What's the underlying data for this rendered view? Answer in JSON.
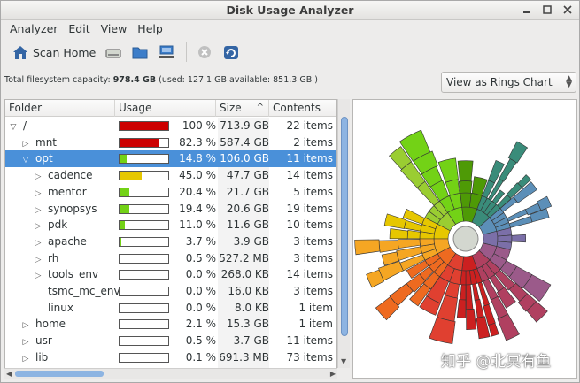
{
  "window": {
    "title": "Disk Usage Analyzer"
  },
  "menu": [
    "Analyzer",
    "Edit",
    "View",
    "Help"
  ],
  "toolbar": {
    "scan_home_label": "Scan Home",
    "buttons": [
      "scan-home",
      "scan-filesystem",
      "scan-folder",
      "scan-remote",
      "stop",
      "refresh"
    ]
  },
  "info": {
    "prefix": "Total filesystem capacity:",
    "capacity": "978.4 GB",
    "details": "(used: 127.1 GB available: 851.3 GB )"
  },
  "view_selector": {
    "value": "View as Rings Chart"
  },
  "columns": {
    "folder": "Folder",
    "usage": "Usage",
    "size": "Size",
    "contents": "Contents"
  },
  "rows": [
    {
      "name": "/",
      "indent": 0,
      "expander": "open",
      "pct": "100 %",
      "fill": 1.0,
      "bar_color": "#cc0000",
      "size": "713.9 GB",
      "items": "22 items",
      "selected": false
    },
    {
      "name": "mnt",
      "indent": 1,
      "expander": "closed",
      "pct": "82.3 %",
      "fill": 0.823,
      "bar_color": "#cc0000",
      "size": "587.4 GB",
      "items": "2 items",
      "selected": false
    },
    {
      "name": "opt",
      "indent": 1,
      "expander": "open",
      "pct": "14.8 %",
      "fill": 0.148,
      "bar_color": "#73d216",
      "size": "106.0 GB",
      "items": "11 items",
      "selected": true
    },
    {
      "name": "cadence",
      "indent": 2,
      "expander": "closed",
      "pct": "45.0 %",
      "fill": 0.45,
      "bar_color": "#e6c700",
      "size": "47.7 GB",
      "items": "14 items",
      "selected": false
    },
    {
      "name": "mentor",
      "indent": 2,
      "expander": "closed",
      "pct": "20.4 %",
      "fill": 0.204,
      "bar_color": "#73d216",
      "size": "21.7 GB",
      "items": "5 items",
      "selected": false
    },
    {
      "name": "synopsys",
      "indent": 2,
      "expander": "closed",
      "pct": "19.4 %",
      "fill": 0.194,
      "bar_color": "#73d216",
      "size": "20.6 GB",
      "items": "19 items",
      "selected": false
    },
    {
      "name": "pdk",
      "indent": 2,
      "expander": "closed",
      "pct": "11.0 %",
      "fill": 0.11,
      "bar_color": "#73d216",
      "size": "11.6 GB",
      "items": "10 items",
      "selected": false
    },
    {
      "name": "apache",
      "indent": 2,
      "expander": "closed",
      "pct": "3.7 %",
      "fill": 0.037,
      "bar_color": "#73d216",
      "size": "3.9 GB",
      "items": "3 items",
      "selected": false
    },
    {
      "name": "rh",
      "indent": 2,
      "expander": "closed",
      "pct": "0.5 %",
      "fill": 0.005,
      "bar_color": "#73d216",
      "size": "527.2 MB",
      "items": "3 items",
      "selected": false
    },
    {
      "name": "tools_env",
      "indent": 2,
      "expander": "closed",
      "pct": "0.0 %",
      "fill": 0.0,
      "bar_color": "#73d216",
      "size": "268.0 KB",
      "items": "14 items",
      "selected": false
    },
    {
      "name": "tsmc_mc_env",
      "indent": 2,
      "expander": "none",
      "pct": "0.0 %",
      "fill": 0.0,
      "bar_color": "#73d216",
      "size": "16.0 KB",
      "items": "3 items",
      "selected": false
    },
    {
      "name": "linux",
      "indent": 2,
      "expander": "none",
      "pct": "0.0 %",
      "fill": 0.0,
      "bar_color": "#73d216",
      "size": "8.0 KB",
      "items": "1 item",
      "selected": false
    },
    {
      "name": "home",
      "indent": 1,
      "expander": "closed",
      "pct": "2.1 %",
      "fill": 0.021,
      "bar_color": "#cc0000",
      "size": "15.3 GB",
      "items": "1 item",
      "selected": false
    },
    {
      "name": "usr",
      "indent": 1,
      "expander": "closed",
      "pct": "0.5 %",
      "fill": 0.005,
      "bar_color": "#cc0000",
      "size": "3.7 GB",
      "items": "11 items",
      "selected": false
    },
    {
      "name": "lib",
      "indent": 1,
      "expander": "closed",
      "pct": "0.1 %",
      "fill": 0.001,
      "bar_color": "#cc0000",
      "size": "691.3 MB",
      "items": "73 items",
      "selected": false
    }
  ],
  "watermark": "知乎 @北冥有鱼"
}
